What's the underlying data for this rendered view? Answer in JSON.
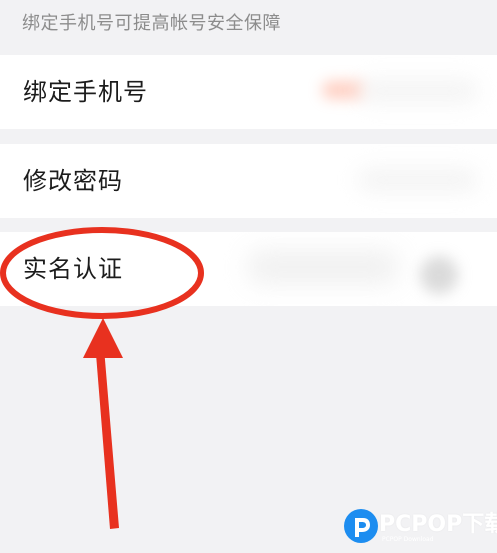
{
  "settings": {
    "section_hint": "绑定手机号可提高帐号安全保障",
    "rows": [
      {
        "label": "绑定手机号"
      },
      {
        "label": "修改密码"
      },
      {
        "label": "实名认证"
      }
    ]
  },
  "annotation": {
    "highlight_color": "#e8311f",
    "shape": "ellipse-circle",
    "arrow_direction": "up"
  },
  "watermark": {
    "brand": "PCPOP下载",
    "subtitle": "PCPOP Download",
    "logo_letter": "P",
    "logo_color": "#1d8df0"
  }
}
